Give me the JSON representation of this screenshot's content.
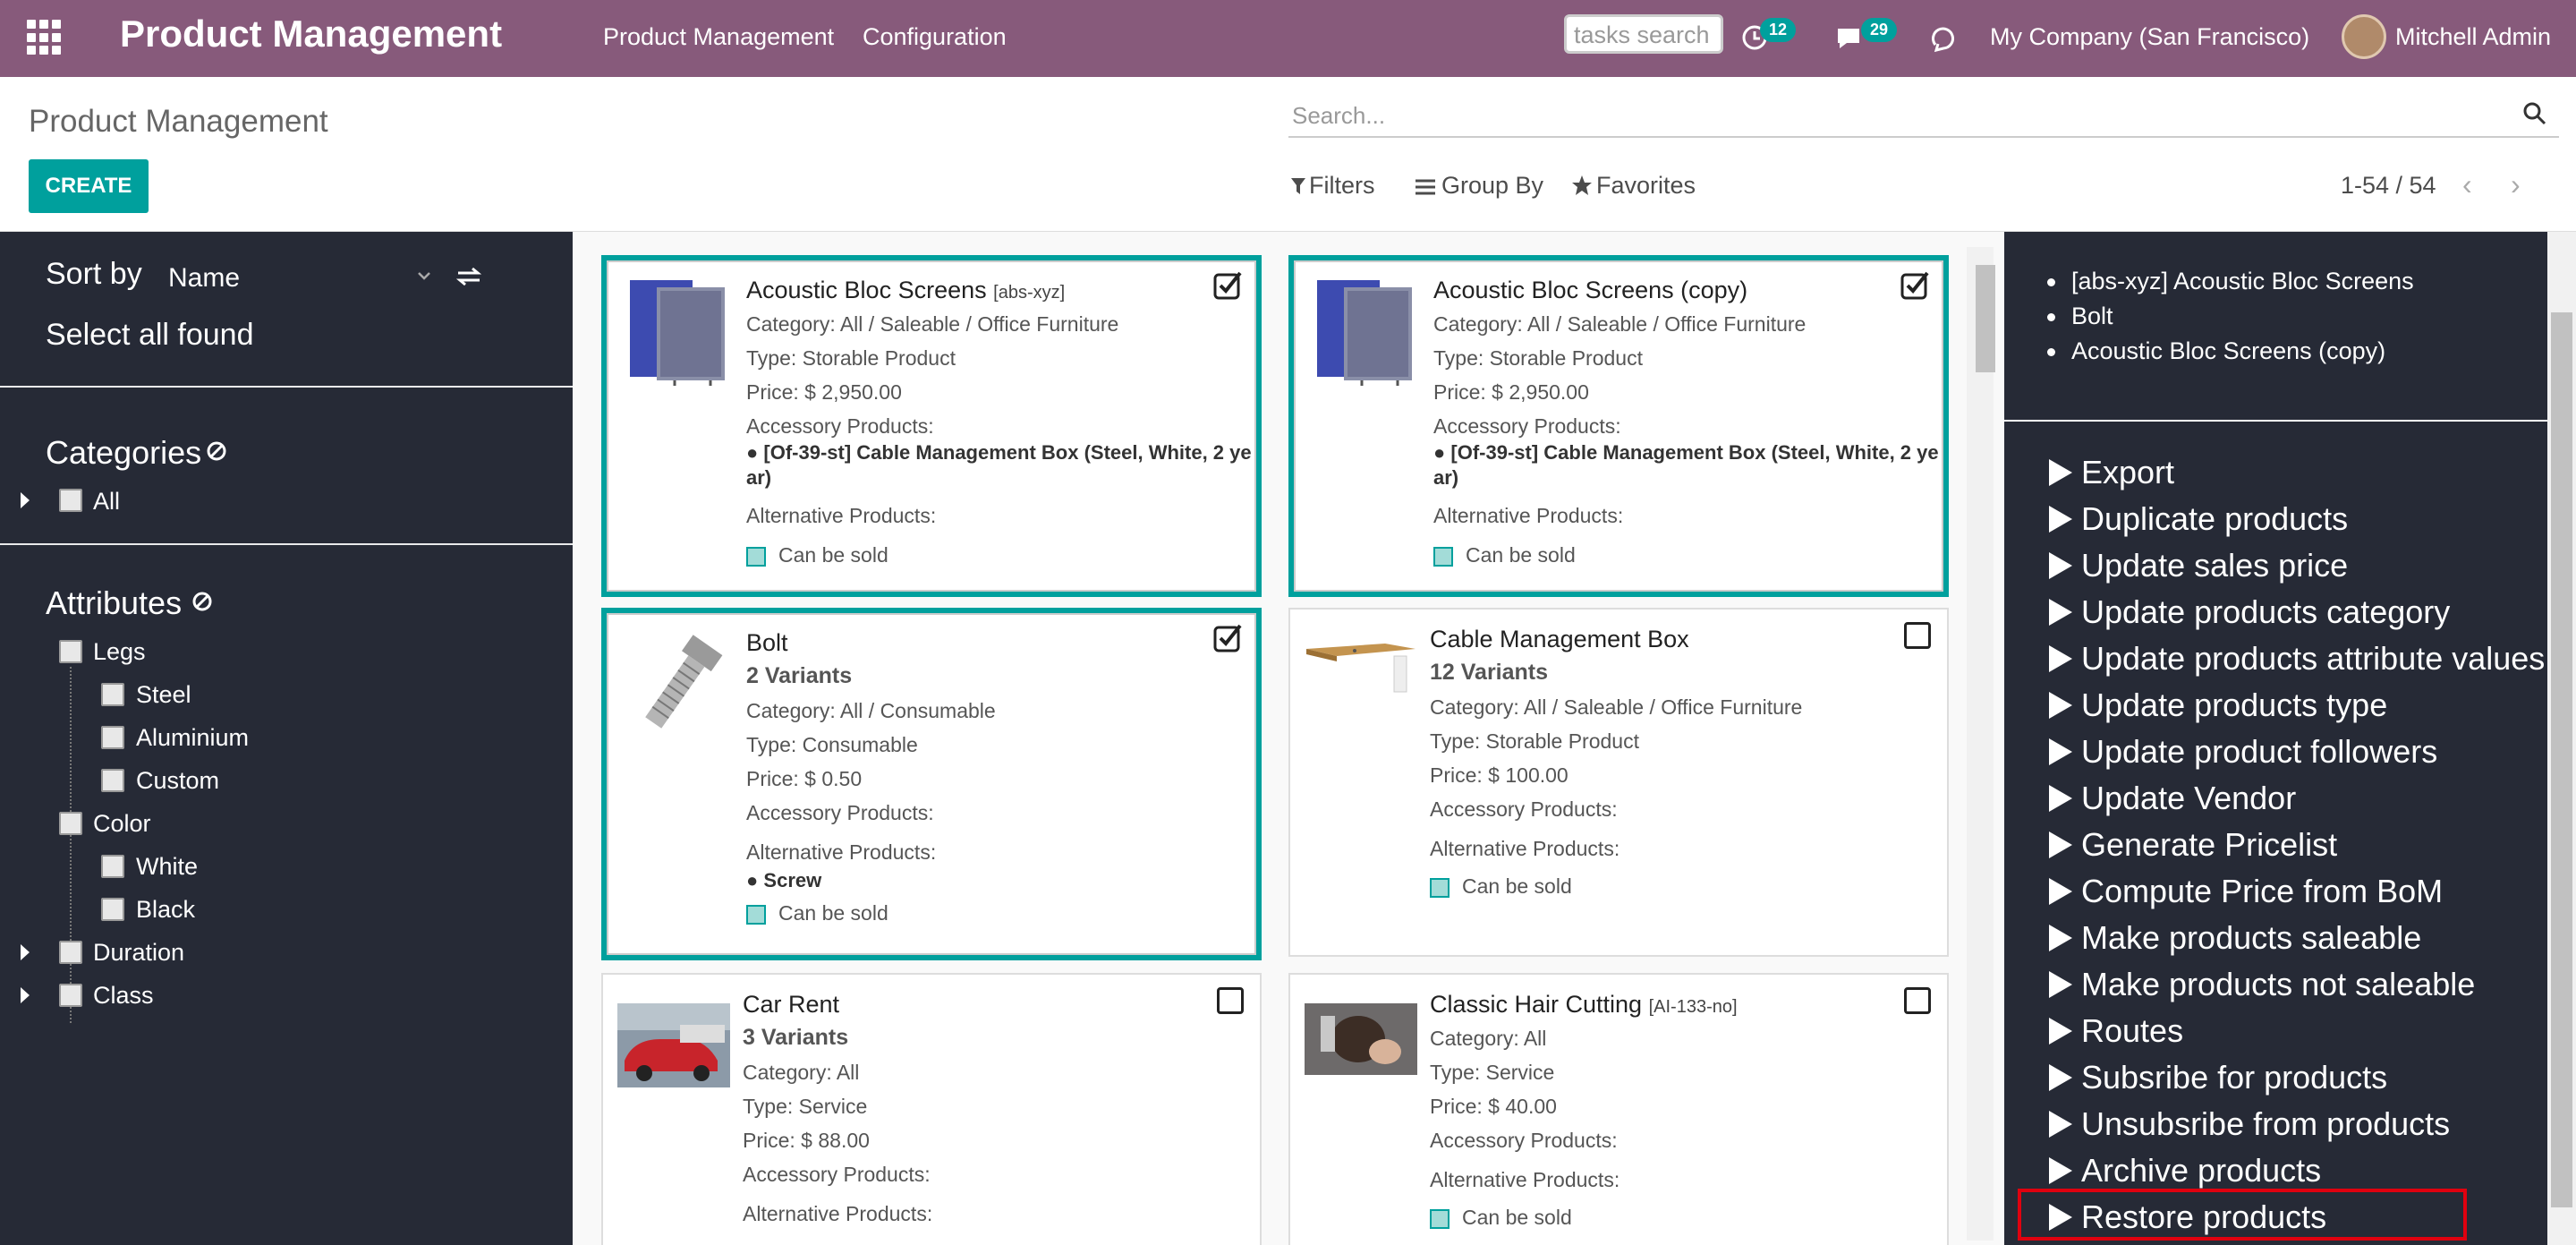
{
  "navbar": {
    "app_title": "Product Management",
    "menu": [
      "Product Management",
      "Configuration"
    ],
    "tasks_placeholder": "tasks search",
    "activity_count": "12",
    "messages_count": "29",
    "company": "My Company (San Francisco)",
    "user": "Mitchell Admin"
  },
  "control_panel": {
    "breadcrumb": "Product Management",
    "create_label": "CREATE",
    "search_placeholder": "Search...",
    "filters_label": "Filters",
    "groupby_label": "Group By",
    "favorites_label": "Favorites",
    "pager": "1-54 / 54"
  },
  "sidebar": {
    "sort_by_label": "Sort by",
    "sort_value": "Name",
    "select_all": "Select all found",
    "categories_title": "Categories",
    "categories": [
      "All"
    ],
    "attributes_title": "Attributes",
    "attributes": [
      {
        "label": "Legs",
        "children": [
          "Steel",
          "Aluminium",
          "Custom"
        ]
      },
      {
        "label": "Color",
        "children": [
          "White",
          "Black"
        ]
      },
      {
        "label": "Duration",
        "children": []
      },
      {
        "label": "Class",
        "children": []
      }
    ]
  },
  "cards": [
    {
      "name": "Acoustic Bloc Screens",
      "ref": "[abs-xyz]",
      "variants": "",
      "category": "Category: All / Saleable / Office Furniture",
      "type": "Type: Storable Product",
      "price": "Price: $ 2,950.00",
      "accessory_label": "Accessory Products:",
      "accessory": "[Of-39-st] Cable Management Box (Steel, White, 2 ye",
      "accessory_wrap": "ar)",
      "alternative_label": "Alternative Products:",
      "alternative": "",
      "can_be_sold": "Can be sold",
      "selected": true
    },
    {
      "name": "Acoustic Bloc Screens (copy)",
      "ref": "",
      "variants": "",
      "category": "Category: All / Saleable / Office Furniture",
      "type": "Type: Storable Product",
      "price": "Price: $ 2,950.00",
      "accessory_label": "Accessory Products:",
      "accessory": "[Of-39-st] Cable Management Box (Steel, White, 2 ye",
      "accessory_wrap": "ar)",
      "alternative_label": "Alternative Products:",
      "alternative": "",
      "can_be_sold": "Can be sold",
      "selected": true
    },
    {
      "name": "Bolt",
      "ref": "",
      "variants": "2 Variants",
      "category": "Category: All / Consumable",
      "type": "Type: Consumable",
      "price": "Price: $ 0.50",
      "accessory_label": "Accessory Products:",
      "accessory": "",
      "accessory_wrap": "",
      "alternative_label": "Alternative Products:",
      "alternative": "Screw",
      "can_be_sold": "Can be sold",
      "selected": true
    },
    {
      "name": "Cable Management Box",
      "ref": "",
      "variants": "12 Variants",
      "category": "Category: All / Saleable / Office Furniture",
      "type": "Type: Storable Product",
      "price": "Price: $ 100.00",
      "accessory_label": "Accessory Products:",
      "accessory": "",
      "accessory_wrap": "",
      "alternative_label": "Alternative Products:",
      "alternative": "",
      "can_be_sold": "Can be sold",
      "selected": false
    },
    {
      "name": "Car Rent",
      "ref": "",
      "variants": "3 Variants",
      "category": "Category: All",
      "type": "Type: Service",
      "price": "Price: $ 88.00",
      "accessory_label": "Accessory Products:",
      "accessory": "",
      "accessory_wrap": "",
      "alternative_label": "Alternative Products:",
      "alternative": "",
      "can_be_sold": "",
      "selected": false
    },
    {
      "name": "Classic Hair Cutting",
      "ref": "[AI-133-no]",
      "variants": "",
      "category": "Category: All",
      "type": "Type: Service",
      "price": "Price: $ 40.00",
      "accessory_label": "Accessory Products:",
      "accessory": "",
      "accessory_wrap": "",
      "alternative_label": "Alternative Products:",
      "alternative": "",
      "can_be_sold": "Can be sold",
      "selected": false
    }
  ],
  "right_panel": {
    "selected_items": [
      "[abs-xyz] Acoustic Bloc Screens",
      "Bolt",
      "Acoustic Bloc Screens (copy)"
    ],
    "actions": [
      "Export",
      "Duplicate products",
      "Update sales price",
      "Update products category",
      "Update products attribute values",
      "Update products type",
      "Update product followers",
      "Update Vendor",
      "Generate Pricelist",
      "Compute Price from BoM",
      "Make products saleable",
      "Make products not saleable",
      "Routes",
      "Subsribe for products",
      "Unsubsribe from products",
      "Archive products",
      "Restore products"
    ]
  },
  "colors": {
    "navbar": "#875a7b",
    "accent": "#00a09d",
    "sidebar": "#262a36",
    "highlight": "#e0000f"
  }
}
